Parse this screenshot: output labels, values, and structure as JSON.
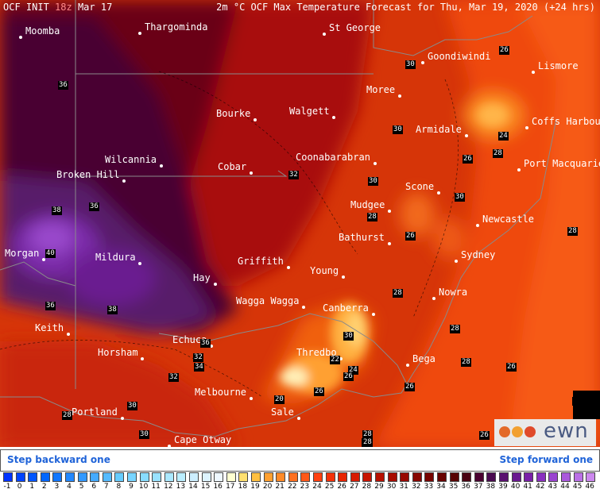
{
  "header": {
    "model": "OCF INIT",
    "run_hour": "18z",
    "run_date": "Mar 17",
    "title": "2m °C OCF Max Temperature Forecast for Thu, Mar 19, 2020 (+24 hrs)"
  },
  "cities": [
    {
      "name": "Moomba",
      "dot": "left"
    },
    {
      "name": "Thargominda",
      "dot": "left"
    },
    {
      "name": "St George",
      "dot": "left"
    },
    {
      "name": "Goondiwindi",
      "dot": "left"
    },
    {
      "name": "Lismore",
      "dot": "left"
    },
    {
      "name": "Moree",
      "dot": "right"
    },
    {
      "name": "Bourke",
      "dot": "right"
    },
    {
      "name": "Walgett",
      "dot": "right"
    },
    {
      "name": "Coffs Harbour",
      "dot": "left"
    },
    {
      "name": "Armidale",
      "dot": "right"
    },
    {
      "name": "Wilcannia",
      "dot": "right"
    },
    {
      "name": "Cobar",
      "dot": "right"
    },
    {
      "name": "Coonabarabran",
      "dot": "right"
    },
    {
      "name": "Port Macquarie",
      "dot": "left"
    },
    {
      "name": "Broken Hill",
      "dot": "right"
    },
    {
      "name": "Scone",
      "dot": "right"
    },
    {
      "name": "Mudgee",
      "dot": "right"
    },
    {
      "name": "Newcastle",
      "dot": "left"
    },
    {
      "name": "Bathurst",
      "dot": "right"
    },
    {
      "name": "Morgan",
      "dot": "right"
    },
    {
      "name": "Mildura",
      "dot": "right"
    },
    {
      "name": "Sydney",
      "dot": "left"
    },
    {
      "name": "Griffith",
      "dot": "right"
    },
    {
      "name": "Young",
      "dot": "right"
    },
    {
      "name": "Hay",
      "dot": "right"
    },
    {
      "name": "Nowra",
      "dot": "left"
    },
    {
      "name": "Wagga Wagga",
      "dot": "right"
    },
    {
      "name": "Canberra",
      "dot": "right"
    },
    {
      "name": "Keith",
      "dot": "right"
    },
    {
      "name": "Echuca",
      "dot": "right"
    },
    {
      "name": "Horsham",
      "dot": "right"
    },
    {
      "name": "Thredbo",
      "dot": "right"
    },
    {
      "name": "Bega",
      "dot": "left"
    },
    {
      "name": "Melbourne",
      "dot": "right"
    },
    {
      "name": "Portland",
      "dot": "right"
    },
    {
      "name": "Sale",
      "dot": "right"
    },
    {
      "name": "Cape Otway",
      "dot": "left"
    }
  ],
  "contour_labels": [
    "36",
    "26",
    "30",
    "30",
    "24",
    "26",
    "28",
    "32",
    "30",
    "30",
    "38",
    "36",
    "28",
    "26",
    "28",
    "40",
    "36",
    "38",
    "28",
    "28",
    "36",
    "30",
    "28",
    "24",
    "32",
    "22",
    "34",
    "26",
    "32",
    "28",
    "20",
    "26",
    "28",
    "30",
    "26",
    "26",
    "30",
    "28",
    "30",
    "28",
    "26"
  ],
  "logo_text": "ewn",
  "nav": {
    "back": "Step backward one",
    "forward": "Step forward one"
  },
  "legend": {
    "labels": [
      "-1",
      "0",
      "1",
      "2",
      "3",
      "4",
      "5",
      "6",
      "7",
      "8",
      "9",
      "10",
      "11",
      "12",
      "13",
      "14",
      "15",
      "16",
      "17",
      "18",
      "19",
      "20",
      "21",
      "22",
      "23",
      "24",
      "25",
      "26",
      "27",
      "28",
      "29",
      "30",
      "31",
      "32",
      "33",
      "34",
      "35",
      "36",
      "37",
      "38",
      "39",
      "40",
      "41",
      "42",
      "43",
      "44",
      "45",
      "46"
    ],
    "colors": [
      "#0033ff",
      "#0044ff",
      "#0055ff",
      "#0066ff",
      "#1177ff",
      "#2288ff",
      "#3399ff",
      "#44aaff",
      "#55bbff",
      "#66ccff",
      "#77d4ff",
      "#88dcff",
      "#99e2ff",
      "#aae8ff",
      "#bbeeff",
      "#cceeff",
      "#ddf4ff",
      "#eef8ff",
      "#ffffd0",
      "#ffe070",
      "#ffc040",
      "#ffa030",
      "#ff8a28",
      "#ff7020",
      "#ff5818",
      "#ff4010",
      "#f43008",
      "#e82400",
      "#d81a00",
      "#c81400",
      "#b81000",
      "#a80c00",
      "#980800",
      "#880600",
      "#780400",
      "#680200",
      "#580000",
      "#4a0012",
      "#4a0030",
      "#4a0a50",
      "#5a1070",
      "#6a1890",
      "#7a20a8",
      "#8a30c0",
      "#9a44d0",
      "#aa58dc",
      "#bb70e6",
      "#cc88ee"
    ]
  }
}
